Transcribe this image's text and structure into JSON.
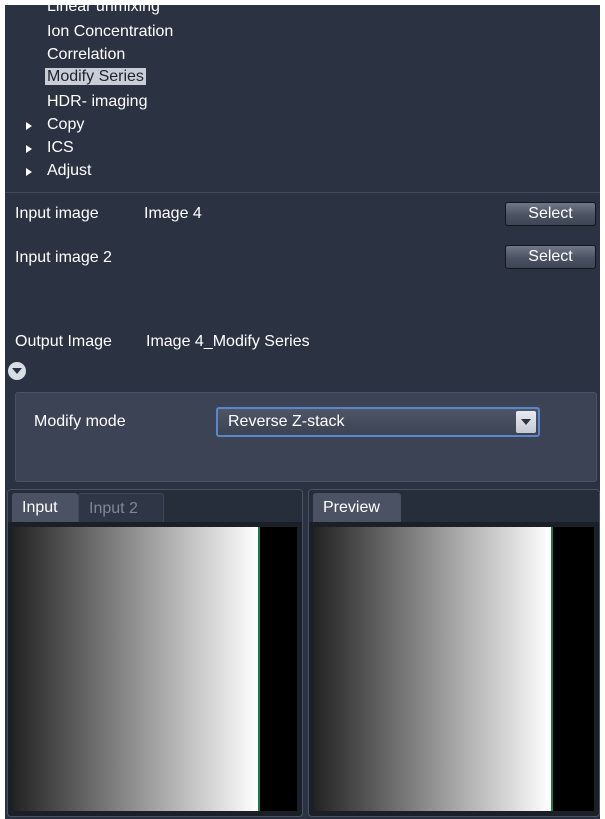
{
  "tree": {
    "items": [
      {
        "label": "Linear unmixing",
        "type": "leaf",
        "selected": false
      },
      {
        "label": "Ion Concentration",
        "type": "leaf",
        "selected": false
      },
      {
        "label": "Correlation",
        "type": "leaf",
        "selected": false
      },
      {
        "label": "Modify Series",
        "type": "leaf",
        "selected": true
      },
      {
        "label": "HDR- imaging",
        "type": "leaf",
        "selected": false
      },
      {
        "label": "Copy",
        "type": "group",
        "selected": false
      },
      {
        "label": "ICS",
        "type": "group",
        "selected": false
      },
      {
        "label": "Adjust",
        "type": "group",
        "selected": false
      }
    ]
  },
  "params": {
    "input_image_label": "Input image",
    "input_image_value": "Image 4",
    "input_image2_label": "Input image 2",
    "select_label": "Select",
    "output_image_label": "Output Image",
    "output_image_value": "Image 4_Modify Series"
  },
  "mode": {
    "label": "Modify mode",
    "value": "Reverse Z-stack"
  },
  "panes": {
    "left_tabs": [
      "Input",
      "Input 2"
    ],
    "right_tabs": [
      "Preview"
    ]
  },
  "colors": {
    "panel_bg": "#2b3343",
    "selection": "#c8cdd6",
    "dropdown_border": "#5a87c9"
  }
}
